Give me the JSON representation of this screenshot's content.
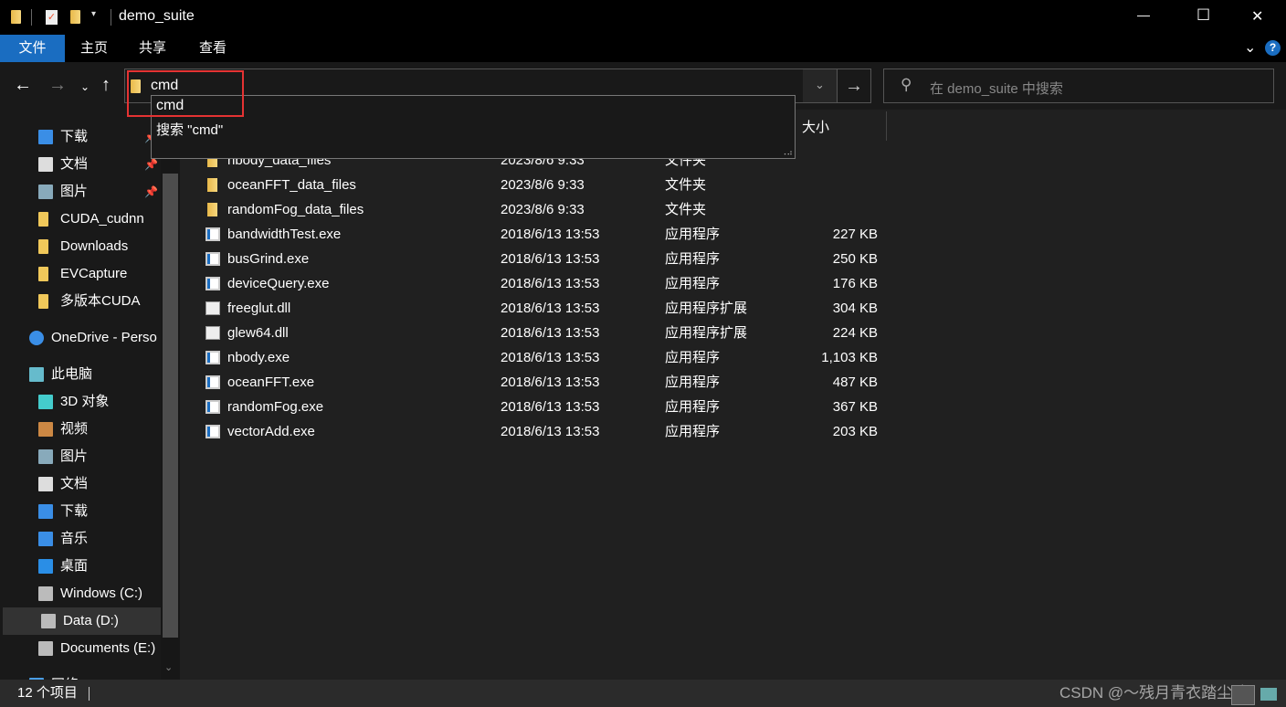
{
  "window": {
    "title": "demo_suite",
    "controls": {
      "minimize": "—",
      "maximize": "☐",
      "close": "✕"
    }
  },
  "ribbon": {
    "tabs": [
      "文件",
      "主页",
      "共享",
      "查看"
    ],
    "active": 0,
    "accent": "#1a6dc1"
  },
  "address": {
    "value": "cmd",
    "suggestions": [
      "cmd",
      "搜索 \"cmd\""
    ]
  },
  "search": {
    "placeholder": "在 demo_suite 中搜索"
  },
  "columns": {
    "size": "大小"
  },
  "sidebar": {
    "items": [
      {
        "label": "下载",
        "icon": "download-icon",
        "pinned": true
      },
      {
        "label": "文档",
        "icon": "document-icon",
        "pinned": true
      },
      {
        "label": "图片",
        "icon": "picture-icon",
        "pinned": true
      },
      {
        "label": "CUDA_cudnn",
        "icon": "folder-icon"
      },
      {
        "label": "Downloads",
        "icon": "folder-icon"
      },
      {
        "label": "EVCapture",
        "icon": "folder-icon"
      },
      {
        "label": "多版本CUDA",
        "icon": "folder-icon"
      },
      {
        "label": "OneDrive - Perso",
        "icon": "onedrive-icon"
      },
      {
        "label": "此电脑",
        "icon": "computer-icon"
      },
      {
        "label": "3D 对象",
        "icon": "cube-icon"
      },
      {
        "label": "视频",
        "icon": "video-icon"
      },
      {
        "label": "图片",
        "icon": "picture-icon"
      },
      {
        "label": "文档",
        "icon": "document-icon"
      },
      {
        "label": "下载",
        "icon": "download-icon"
      },
      {
        "label": "音乐",
        "icon": "music-icon"
      },
      {
        "label": "桌面",
        "icon": "desktop-icon"
      },
      {
        "label": "Windows (C:)",
        "icon": "drive-icon"
      },
      {
        "label": "Data (D:)",
        "icon": "drive-icon",
        "selected": true
      },
      {
        "label": "Documents (E:)",
        "icon": "drive-icon"
      },
      {
        "label": "网络",
        "icon": "network-icon"
      }
    ]
  },
  "files": [
    {
      "name": "nbody_data_files",
      "date": "2023/8/6 9:33",
      "type": "文件夹",
      "size": "",
      "icon": "folder"
    },
    {
      "name": "oceanFFT_data_files",
      "date": "2023/8/6 9:33",
      "type": "文件夹",
      "size": "",
      "icon": "folder"
    },
    {
      "name": "randomFog_data_files",
      "date": "2023/8/6 9:33",
      "type": "文件夹",
      "size": "",
      "icon": "folder"
    },
    {
      "name": "bandwidthTest.exe",
      "date": "2018/6/13 13:53",
      "type": "应用程序",
      "size": "227 KB",
      "icon": "exe"
    },
    {
      "name": "busGrind.exe",
      "date": "2018/6/13 13:53",
      "type": "应用程序",
      "size": "250 KB",
      "icon": "exe"
    },
    {
      "name": "deviceQuery.exe",
      "date": "2018/6/13 13:53",
      "type": "应用程序",
      "size": "176 KB",
      "icon": "exe"
    },
    {
      "name": "freeglut.dll",
      "date": "2018/6/13 13:53",
      "type": "应用程序扩展",
      "size": "304 KB",
      "icon": "dll"
    },
    {
      "name": "glew64.dll",
      "date": "2018/6/13 13:53",
      "type": "应用程序扩展",
      "size": "224 KB",
      "icon": "dll"
    },
    {
      "name": "nbody.exe",
      "date": "2018/6/13 13:53",
      "type": "应用程序",
      "size": "1,103 KB",
      "icon": "exe"
    },
    {
      "name": "oceanFFT.exe",
      "date": "2018/6/13 13:53",
      "type": "应用程序",
      "size": "487 KB",
      "icon": "exe"
    },
    {
      "name": "randomFog.exe",
      "date": "2018/6/13 13:53",
      "type": "应用程序",
      "size": "367 KB",
      "icon": "exe"
    },
    {
      "name": "vectorAdd.exe",
      "date": "2018/6/13 13:53",
      "type": "应用程序",
      "size": "203 KB",
      "icon": "exe"
    }
  ],
  "status": {
    "count": "12 个项目"
  },
  "watermark": "CSDN @～残月青衣踏尘吟"
}
